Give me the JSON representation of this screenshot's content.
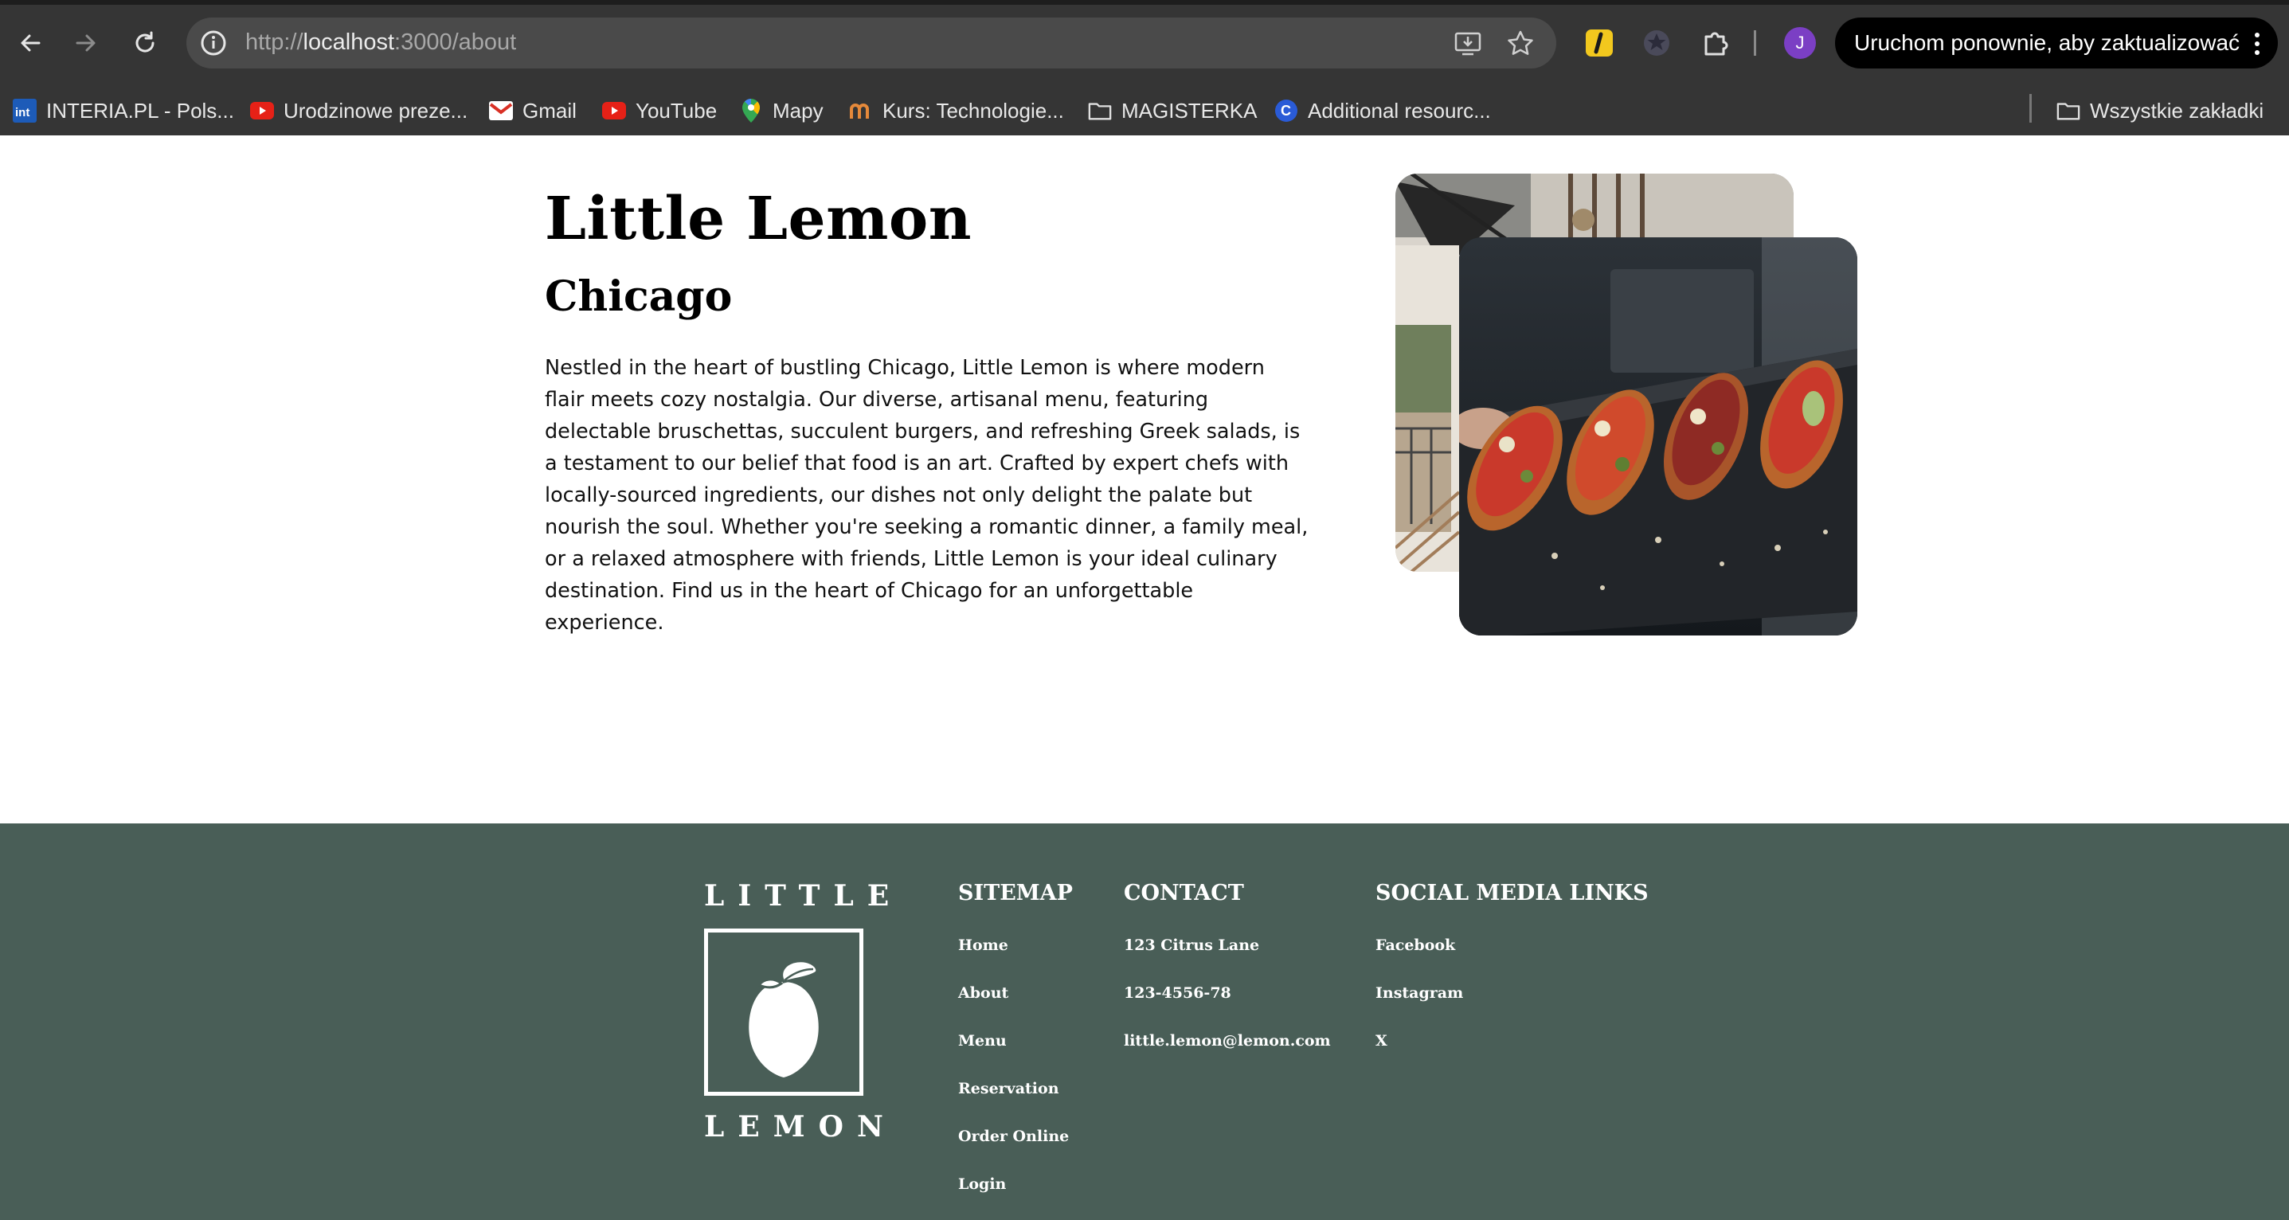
{
  "browser": {
    "url_prefix": "http://",
    "url_host": "localhost",
    "url_path": ":3000/about",
    "profile_initial": "J",
    "update_button": "Uruchom ponownie, aby zaktualizować"
  },
  "bookmarks": [
    {
      "label": "INTERIA.PL - Pols...",
      "icon": "interia-icon"
    },
    {
      "label": "Urodzinowe preze...",
      "icon": "youtube-icon"
    },
    {
      "label": "Gmail",
      "icon": "gmail-icon"
    },
    {
      "label": "YouTube",
      "icon": "youtube-icon"
    },
    {
      "label": "Mapy",
      "icon": "maps-icon"
    },
    {
      "label": "Kurs: Technologie...",
      "icon": "course-icon"
    },
    {
      "label": "MAGISTERKA",
      "icon": "folder-icon"
    },
    {
      "label": "Additional resourc...",
      "icon": "coursera-icon"
    }
  ],
  "all_bookmarks": "Wszystkie zakładki",
  "about": {
    "title": "Little Lemon",
    "subtitle": "Chicago",
    "description": "Nestled in the heart of bustling Chicago, Little Lemon is where modern flair meets cozy nostalgia. Our diverse, artisanal menu, featuring delectable bruschettas, succulent burgers, and refreshing Greek salads, is a testament to our belief that food is an art. Crafted by expert chefs with locally-sourced ingredients, our dishes not only delight the palate but nourish the soul. Whether you're seeking a romantic dinner, a family meal, or a relaxed atmosphere with friends, Little Lemon is your ideal culinary destination. Find us in the heart of Chicago for an unforgettable experience."
  },
  "footer": {
    "logo_top": "LITTLE",
    "logo_bottom": "LEMON",
    "sitemap": {
      "heading": "SITEMAP",
      "links": [
        "Home",
        "About",
        "Menu",
        "Reservation",
        "Order Online",
        "Login"
      ]
    },
    "contact": {
      "heading": "CONTACT",
      "items": [
        "123 Citrus Lane",
        "123-4556-78",
        "little.lemon@lemon.com"
      ]
    },
    "social": {
      "heading": "SOCIAL MEDIA LINKS",
      "links": [
        "Facebook",
        "Instagram",
        "X"
      ]
    }
  },
  "colors": {
    "footer_bg": "#495e57",
    "chrome_bg": "#353535"
  }
}
